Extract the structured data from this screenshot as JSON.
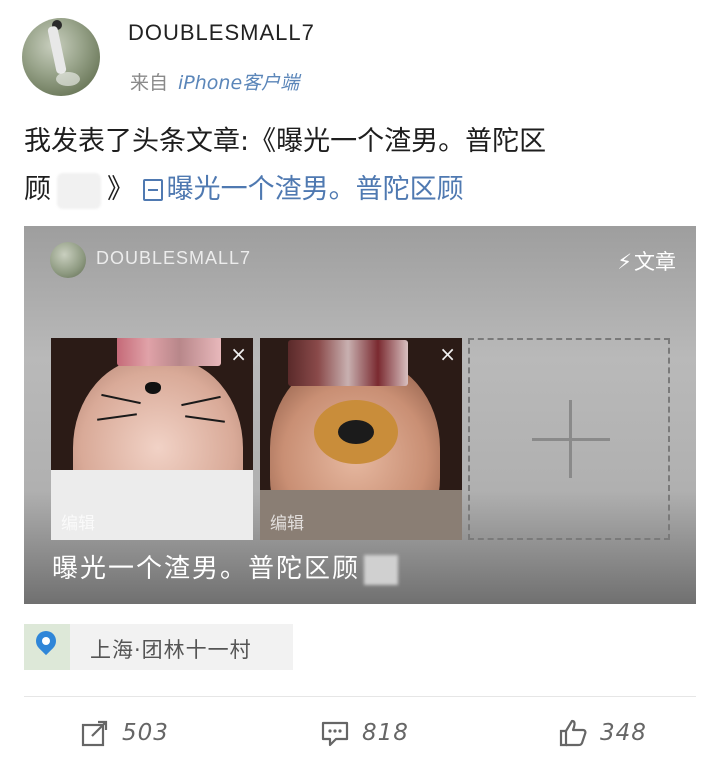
{
  "post": {
    "username": "DOUBLESMALL7",
    "source_prefix": "来自",
    "source_app": "iPhone客户端",
    "text_line1": "我发表了头条文章:《曝光一个渣男。普陀区",
    "text_line2_prefix": "顾",
    "text_line2_suffix": "》",
    "link_text": "曝光一个渣男。普陀区顾"
  },
  "card": {
    "username": "DOUBLESMALL7",
    "tag": "文章",
    "title": "曝光一个渣男。普陀区顾",
    "images": [
      {
        "edit_label": "编辑",
        "close": "×"
      },
      {
        "edit_label": "编辑",
        "close": "×"
      }
    ]
  },
  "location": {
    "text": "上海·团林十一村"
  },
  "actions": {
    "repost_count": "503",
    "comment_count": "818",
    "like_count": "348"
  },
  "colors": {
    "link": "#4f79b1",
    "accent_blue": "#2f86d8"
  }
}
